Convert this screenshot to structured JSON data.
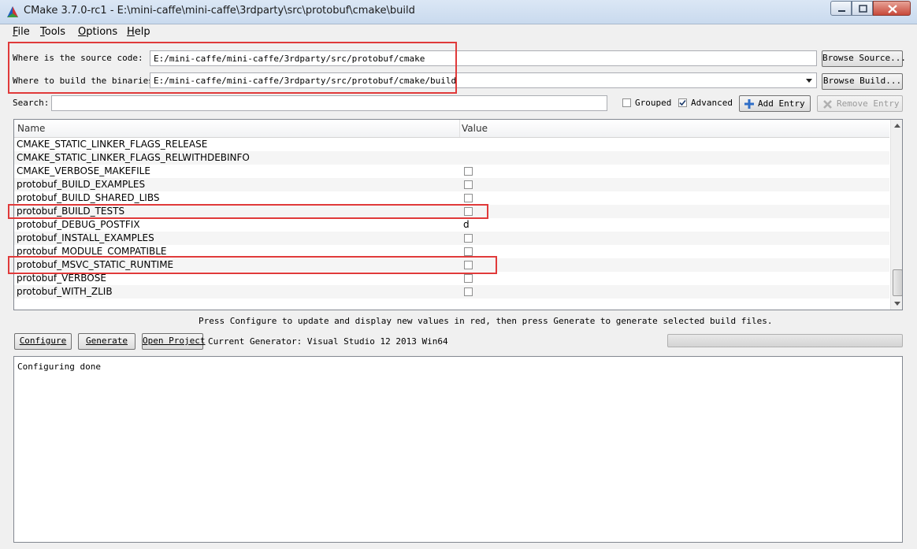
{
  "window": {
    "title": "CMake 3.7.0-rc1 - E:\\mini-caffe\\mini-caffe\\3rdparty\\src\\protobuf\\cmake\\build"
  },
  "menu": [
    {
      "label": "File",
      "mnemonic": "F",
      "rest": "ile"
    },
    {
      "label": "Tools",
      "mnemonic": "T",
      "rest": "ools"
    },
    {
      "label": "Options",
      "mnemonic": "O",
      "rest": "ptions"
    },
    {
      "label": "Help",
      "mnemonic": "H",
      "rest": "elp"
    }
  ],
  "source": {
    "label": "Where is the source code:",
    "value": "E:/mini-caffe/mini-caffe/3rdparty/src/protobuf/cmake",
    "button": "Browse Source..."
  },
  "binaries": {
    "label": "Where to build the binaries:",
    "value": "E:/mini-caffe/mini-caffe/3rdparty/src/protobuf/cmake/build",
    "button": "Browse Build..."
  },
  "search": {
    "label": "Search:",
    "value": ""
  },
  "options": {
    "grouped": {
      "label": "Grouped",
      "checked": false
    },
    "advanced": {
      "label": "Advanced",
      "checked": true
    },
    "add_entry": "Add Entry",
    "remove_entry": "Remove Entry"
  },
  "table": {
    "columns": [
      "Name",
      "Value"
    ],
    "rows": [
      {
        "name": "CMAKE_STATIC_LINKER_FLAGS_RELEASE",
        "type": "text",
        "value": ""
      },
      {
        "name": "CMAKE_STATIC_LINKER_FLAGS_RELWITHDEBINFO",
        "type": "text",
        "value": ""
      },
      {
        "name": "CMAKE_VERBOSE_MAKEFILE",
        "type": "bool",
        "checked": false
      },
      {
        "name": "protobuf_BUILD_EXAMPLES",
        "type": "bool",
        "checked": false
      },
      {
        "name": "protobuf_BUILD_SHARED_LIBS",
        "type": "bool",
        "checked": false
      },
      {
        "name": "protobuf_BUILD_TESTS",
        "type": "bool",
        "checked": false
      },
      {
        "name": "protobuf_DEBUG_POSTFIX",
        "type": "text",
        "value": "d"
      },
      {
        "name": "protobuf_INSTALL_EXAMPLES",
        "type": "bool",
        "checked": false
      },
      {
        "name": "protobuf_MODULE_COMPATIBLE",
        "type": "bool",
        "checked": false
      },
      {
        "name": "protobuf_MSVC_STATIC_RUNTIME",
        "type": "bool",
        "checked": false
      },
      {
        "name": "protobuf_VERBOSE",
        "type": "bool",
        "checked": false
      },
      {
        "name": "protobuf_WITH_ZLIB",
        "type": "bool",
        "checked": false
      }
    ]
  },
  "hint": "Press Configure to update and display new values in red, then press Generate to generate selected build files.",
  "actions": {
    "configure": "Configure",
    "generate": "Generate",
    "open_project": "Open Project",
    "generator": "Current Generator: Visual Studio 12 2013 Win64"
  },
  "output": "Configuring done",
  "colors": {
    "highlight": "#e03a3a",
    "title_bar": "#c9daee"
  }
}
